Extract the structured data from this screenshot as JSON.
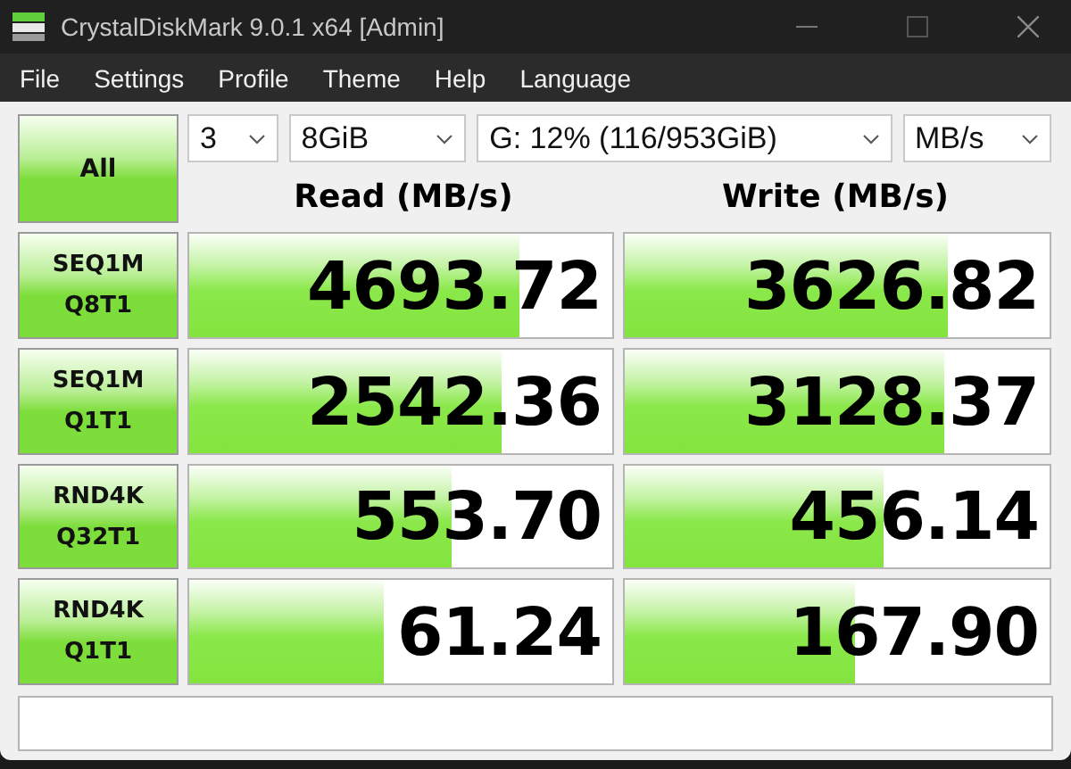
{
  "window": {
    "title": "CrystalDiskMark 9.0.1 x64 [Admin]"
  },
  "menu": [
    "File",
    "Settings",
    "Profile",
    "Theme",
    "Help",
    "Language"
  ],
  "all_button": "All",
  "selectors": [
    {
      "value": "3"
    },
    {
      "value": "8GiB"
    },
    {
      "value": "G: 12% (116/953GiB)"
    },
    {
      "value": "MB/s"
    }
  ],
  "columns": [
    "Read (MB/s)",
    "Write (MB/s)"
  ],
  "tests": [
    {
      "label": [
        "SEQ1M",
        "Q8T1"
      ],
      "read": {
        "value": "4693.72",
        "level": 0.78
      },
      "write": {
        "value": "3626.82",
        "level": 0.76
      }
    },
    {
      "label": [
        "SEQ1M",
        "Q1T1"
      ],
      "read": {
        "value": "2542.36",
        "level": 0.74
      },
      "write": {
        "value": "3128.37",
        "level": 0.75
      }
    },
    {
      "label": [
        "RND4K",
        "Q32T1"
      ],
      "read": {
        "value": "553.70",
        "level": 0.62
      },
      "write": {
        "value": "456.14",
        "level": 0.61
      }
    },
    {
      "label": [
        "RND4K",
        "Q1T1"
      ],
      "read": {
        "value": "61.24",
        "level": 0.46
      },
      "write": {
        "value": "167.90",
        "level": 0.54
      }
    }
  ]
}
